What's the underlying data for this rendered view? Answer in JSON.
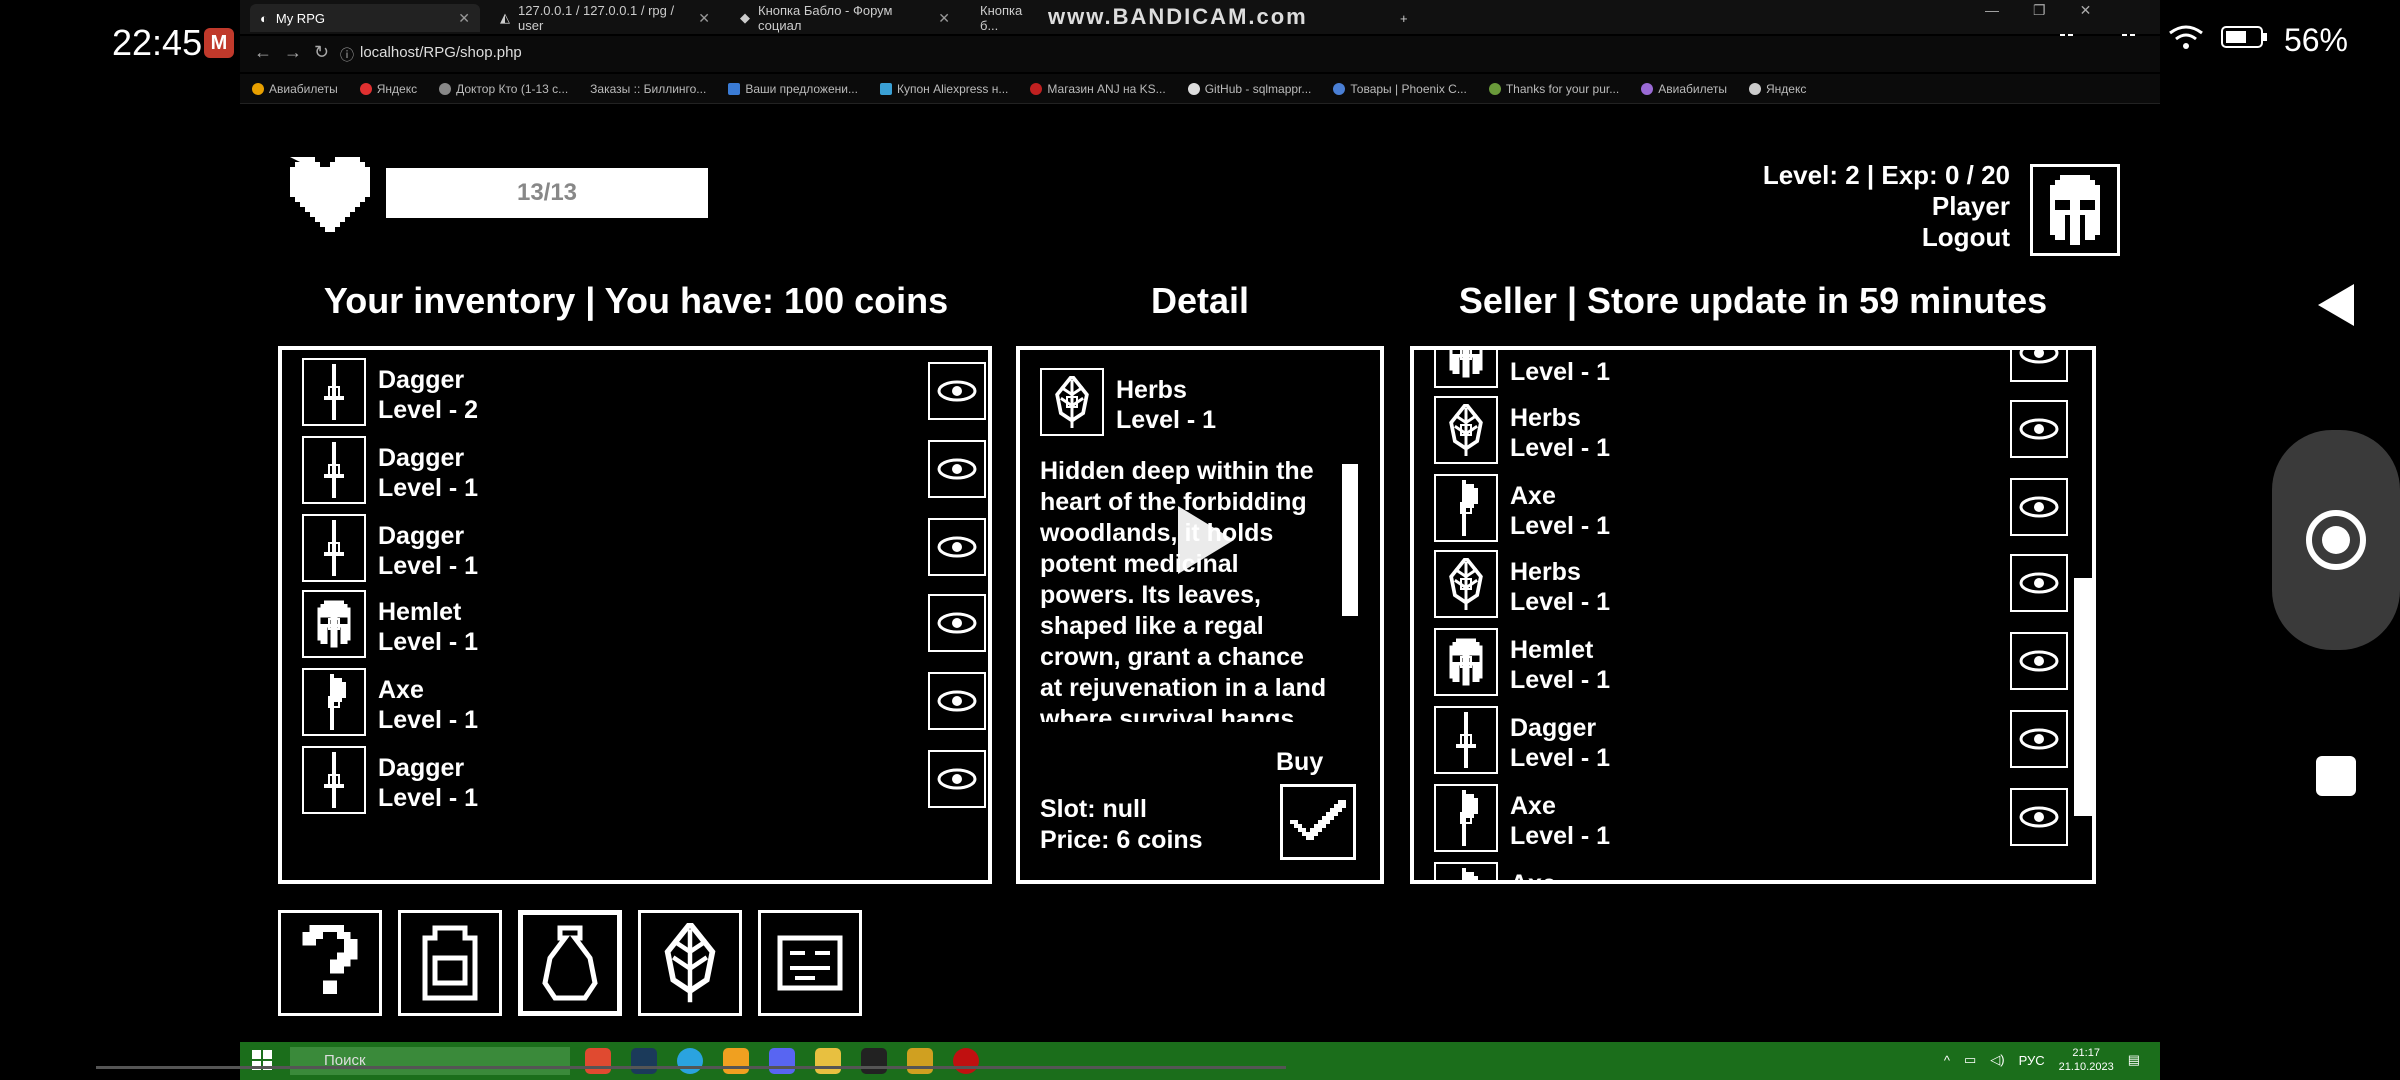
{
  "phone_status": {
    "time": "22:45",
    "battery": "56%"
  },
  "browser": {
    "tabs": [
      {
        "label": "My RPG",
        "active": true
      },
      {
        "label": "127.0.0.1 / 127.0.0.1 / rpg / user"
      },
      {
        "label": "Кнопка Бабло - Форум социал"
      },
      {
        "label": "Кнопка б..."
      }
    ],
    "watermark": "www.BANDICAM.com",
    "url": "localhost/RPG/shop.php",
    "bookmarks": [
      "Авиабилеты",
      "Яндекс",
      "Доктор Кто (1-13 с...",
      "Заказы :: Биллинго...",
      "Ваши предложени...",
      "Купон Aliexpress н...",
      "Магазин ANJ на KS...",
      "GitHub - sqlmappr...",
      "Товары | Phoenix C...",
      "Thanks for your pur...",
      "Авиабилеты",
      "Яндекс"
    ]
  },
  "game": {
    "hp": "13/13",
    "user": {
      "level_exp": "Level: 2 | Exp: 0 / 20",
      "name": "Player",
      "logout": "Logout"
    },
    "inventory": {
      "heading": "Your inventory | You have: 100 coins",
      "items": [
        {
          "name": "Dagger",
          "level": "Level - 2",
          "icon": "dagger-icon"
        },
        {
          "name": "Dagger",
          "level": "Level - 1",
          "icon": "dagger-icon"
        },
        {
          "name": "Dagger",
          "level": "Level - 1",
          "icon": "dagger-icon"
        },
        {
          "name": "Hemlet",
          "level": "Level - 1",
          "icon": "helmet-icon"
        },
        {
          "name": "Axe",
          "level": "Level - 1",
          "icon": "axe-icon"
        },
        {
          "name": "Dagger",
          "level": "Level - 1",
          "icon": "dagger-icon"
        }
      ]
    },
    "detail": {
      "heading": "Detail",
      "name": "Herbs",
      "level": "Level - 1",
      "description": "Hidden deep within the heart of the forbidding woodlands, it holds potent medicinal powers. Its leaves, shaped like a regal crown, grant a chance at rejuvenation in a land where survival hangs by",
      "buy_label": "Buy",
      "slot": "Slot: null",
      "price": "Price: 6 coins"
    },
    "seller": {
      "heading": "Seller | Store update in 59 minutes",
      "items": [
        {
          "name": "",
          "level": "Level - 1",
          "icon": "helmet-icon"
        },
        {
          "name": "Herbs",
          "level": "Level - 1",
          "icon": "leaf-icon"
        },
        {
          "name": "Axe",
          "level": "Level - 1",
          "icon": "axe-icon"
        },
        {
          "name": "Herbs",
          "level": "Level - 1",
          "icon": "leaf-icon"
        },
        {
          "name": "Hemlet",
          "level": "Level - 1",
          "icon": "helmet-icon"
        },
        {
          "name": "Dagger",
          "level": "Level - 1",
          "icon": "dagger-icon"
        },
        {
          "name": "Axe",
          "level": "Level - 1",
          "icon": "axe-icon"
        },
        {
          "name": "Axe",
          "level": "",
          "icon": "axe-icon"
        }
      ]
    },
    "bottom_buttons": [
      "help-button",
      "backpack-button",
      "coin-bag-button",
      "herbs-button",
      "map-button"
    ]
  },
  "taskbar": {
    "search_placeholder": "Поиск",
    "lang": "РУС",
    "time": "21:17",
    "date": "21.10.2023"
  }
}
